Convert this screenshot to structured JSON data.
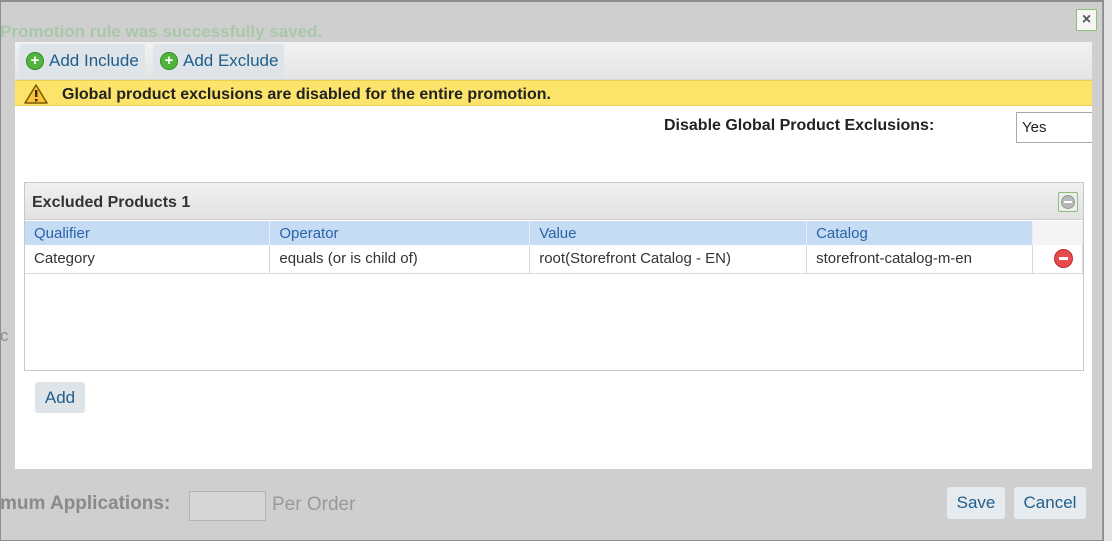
{
  "background": {
    "success_message": "Promotion rule was successfully saved.",
    "partial_label_c": "c",
    "max_applications_label": "mum Applications:",
    "per_order_label": "Per Order",
    "save_label": "Save",
    "cancel_label": "Cancel"
  },
  "dialog": {
    "close_symbol": "×",
    "toolbar": {
      "add_include_label": "Add Include",
      "add_exclude_label": "Add Exclude"
    },
    "warning": {
      "text": "Global product exclusions are disabled for the entire promotion.",
      "color": "#fce36a"
    },
    "disable_global_exclusions": {
      "label": "Disable Global Product Exclusions:",
      "value": "Yes"
    },
    "excluded_products": {
      "title": "Excluded Products 1",
      "columns": [
        "Qualifier",
        "Operator",
        "Value",
        "Catalog"
      ],
      "rows": [
        {
          "qualifier": "Category",
          "operator": "equals (or is child of)",
          "value": "root(Storefront Catalog - EN)",
          "catalog": "storefront-catalog-m-en"
        }
      ]
    },
    "add_label": "Add"
  },
  "icons": {
    "close": "close-icon",
    "add_include": "plus-circle-icon",
    "add_exclude": "plus-circle-icon",
    "warning": "warning-triangle-icon",
    "collapse": "minus-circle-icon",
    "delete_row": "delete-circle-icon"
  },
  "colors": {
    "accent_text": "#1f5e8d",
    "header_row": "#c6dcf5",
    "success_text": "#a9c8a9"
  }
}
